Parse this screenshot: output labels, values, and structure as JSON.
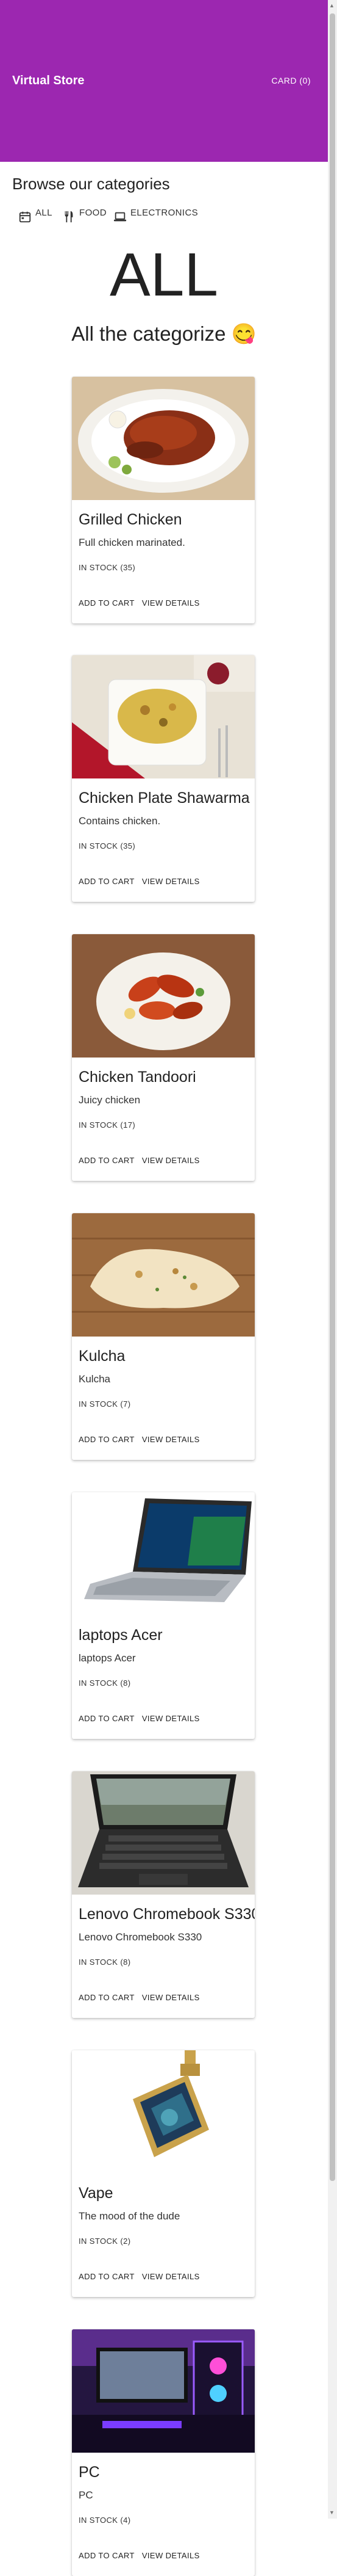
{
  "appbar": {
    "brand": "Virtual Store",
    "cart_label": "CARD (0)",
    "color": "#9c27b0"
  },
  "browse_title": "Browse our categories",
  "categories": [
    {
      "label": "ALL",
      "icon": "calendar-icon"
    },
    {
      "label": "FOOD",
      "icon": "utensils-icon"
    },
    {
      "label": "ELECTRONICS",
      "icon": "laptop-icon"
    }
  ],
  "current_category": "ALL",
  "subtitle": "All the categorize 😋",
  "products": [
    {
      "title": "Grilled Chicken",
      "description": "Full chicken marinated.",
      "stock": "IN STOCK (35)",
      "add_label": "ADD TO CART",
      "view_label": "VIEW DETAILS"
    },
    {
      "title": "Chicken Plate Shawarma",
      "description": "Contains chicken.",
      "stock": "IN STOCK (35)",
      "add_label": "ADD TO CART",
      "view_label": "VIEW DETAILS"
    },
    {
      "title": "Chicken Tandoori",
      "description": "Juicy chicken",
      "stock": "IN STOCK (17)",
      "add_label": "ADD TO CART",
      "view_label": "VIEW DETAILS"
    },
    {
      "title": "Kulcha",
      "description": "Kulcha",
      "stock": "IN STOCK (7)",
      "add_label": "ADD TO CART",
      "view_label": "VIEW DETAILS"
    },
    {
      "title": "laptops Acer",
      "description": "laptops Acer",
      "stock": "IN STOCK (8)",
      "add_label": "ADD TO CART",
      "view_label": "VIEW DETAILS"
    },
    {
      "title": "Lenovo Chromebook S330",
      "description": "Lenovo Chromebook S330",
      "stock": "IN STOCK (8)",
      "add_label": "ADD TO CART",
      "view_label": "VIEW DETAILS"
    },
    {
      "title": "Vape",
      "description": "The mood of the dude",
      "stock": "IN STOCK (2)",
      "add_label": "ADD TO CART",
      "view_label": "VIEW DETAILS"
    },
    {
      "title": "PC",
      "description": "PC",
      "stock": "IN STOCK (4)",
      "add_label": "ADD TO CART",
      "view_label": "VIEW DETAILS"
    }
  ]
}
